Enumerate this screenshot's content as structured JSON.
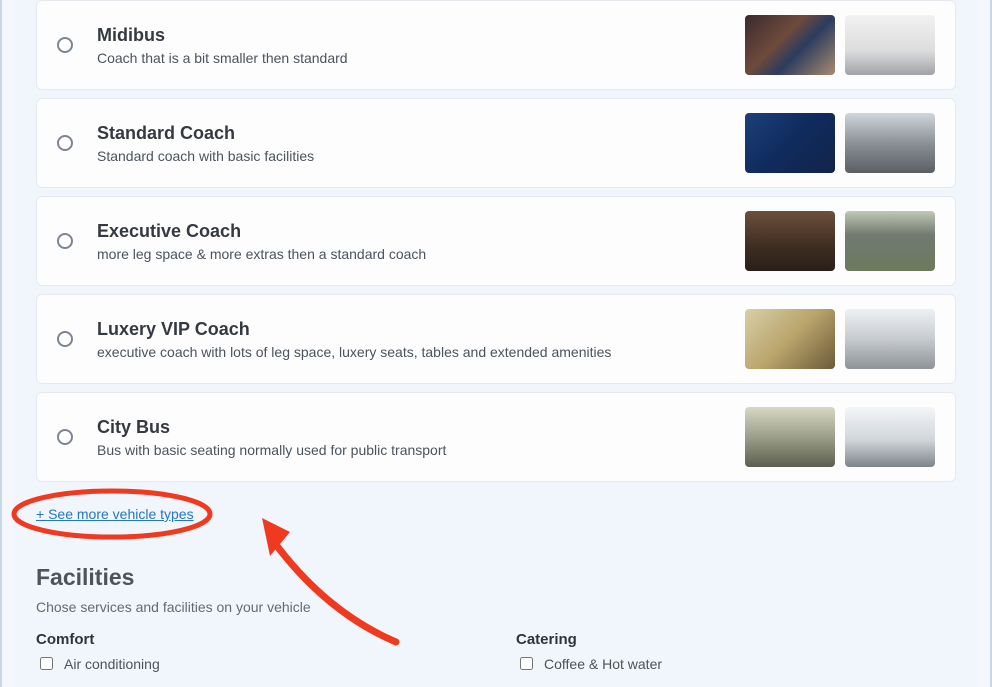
{
  "vehicles": [
    {
      "title": "Midibus",
      "desc": "Coach that is a bit smaller then standard",
      "img1": "linear-gradient(135deg,#3b2a2e 0%,#6e4a3c 40%,#2c3c5e 60%,#a98b70 100%)",
      "img2": "linear-gradient(180deg,#f2f2f2 0%,#dcdcdc 60%,#9fa2a6 100%)"
    },
    {
      "title": "Standard Coach",
      "desc": "Standard coach with basic facilities",
      "img1": "linear-gradient(135deg,#1e3f7a 0%,#0f2b5d 50%,#12244a 100%)",
      "img2": "linear-gradient(180deg,#cfd6dc 0%,#8a9197 50%,#5a5f64 100%)"
    },
    {
      "title": "Executive Coach",
      "desc": "more leg space & more extras then a standard coach",
      "img1": "linear-gradient(180deg,#6c503c 0%,#3d2d21 60%,#2a1f18 100%)",
      "img2": "linear-gradient(180deg,#bfc9b4 0%,#717a70 40%,#6c7a5d 100%)"
    },
    {
      "title": "Luxery VIP Coach",
      "desc": "executive coach with lots of leg space, luxery seats, tables and extended amenities",
      "img1": "linear-gradient(135deg,#d8cfa8 0%,#b9a46b 50%,#6a5a38 100%)",
      "img2": "linear-gradient(180deg,#eef1f4 0%,#c7cbcf 50%,#8e9398 100%)"
    },
    {
      "title": "City Bus",
      "desc": "Bus with basic seating normally used for public transport",
      "img1": "linear-gradient(180deg,#d7d9c4 0%,#9b9e88 50%,#5d5f50 100%)",
      "img2": "linear-gradient(180deg,#f4f6f8 0%,#d1d5d9 55%,#7d848a 100%)"
    }
  ],
  "see_more": "+ See more vehicle types",
  "facilities": {
    "title": "Facilities",
    "sub": "Chose services and facilities on your vehicle",
    "cols": [
      {
        "title": "Comfort",
        "items": [
          "Air conditioning"
        ]
      },
      {
        "title": "Catering",
        "items": [
          "Coffee & Hot water"
        ]
      }
    ]
  },
  "annotation": {
    "color": "#f03a1f"
  }
}
